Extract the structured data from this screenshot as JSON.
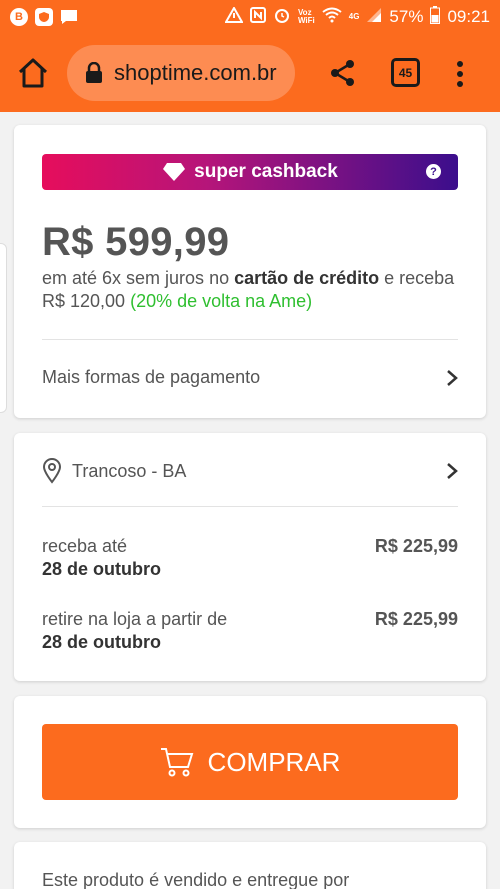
{
  "statusbar": {
    "left_icons": [
      "b-badge-icon",
      "shield-app-icon",
      "message-icon"
    ],
    "vowifi": "Voz\nWiFi",
    "network": "4G",
    "battery": "57%",
    "time": "09:21"
  },
  "browser": {
    "url": "shoptime.com.br",
    "tab_count": "45"
  },
  "payment": {
    "badge": "super cashback",
    "badge_help": "?",
    "price": "R$ 599,99",
    "installments_pre": "em até 6x sem juros no ",
    "installments_bold": "cartão de crédito",
    "installments_mid": " e receba R$ 120,00 ",
    "installments_green": "(20% de volta na Ame)",
    "more_options": "Mais formas de pagamento"
  },
  "shipping": {
    "location": "Trancoso - BA",
    "options": [
      {
        "label": "receba até",
        "date": "28 de outubro",
        "price": "R$ 225,99"
      },
      {
        "label": "retire na loja a partir de",
        "date": "28 de outubro",
        "price": "R$ 225,99"
      }
    ]
  },
  "purchase": {
    "buy_label": "COMPRAR"
  },
  "seller": {
    "text": "Este produto é vendido e entregue por"
  },
  "colors": {
    "brand_orange": "#fc6b1e",
    "cashback_start": "#e60d5c",
    "cashback_end": "#3b0e8c",
    "green": "#2fbf30"
  }
}
